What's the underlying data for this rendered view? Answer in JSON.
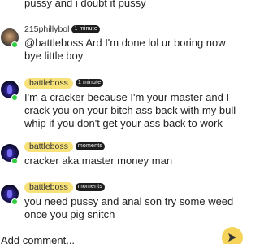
{
  "comments": [
    {
      "username": "",
      "time": "",
      "text": "pussy and i doubt it pussy"
    },
    {
      "username": "215phillybol",
      "time": "1 minute",
      "text": "@battleboss Ard I'm done lol ur boring now bye little boy"
    },
    {
      "username": "battleboss",
      "time": "1 minute",
      "text": "I'm a cracker because I'm your master and I crack you on your bitch ass back with my bull whip if you don't get your ass back to work"
    },
    {
      "username": "battleboss",
      "time": "moments",
      "text": "cracker aka master money man"
    },
    {
      "username": "battleboss",
      "time": "moments",
      "text": "you need pussy and anal son try some weed once you pig snitch"
    }
  ],
  "composer": {
    "placeholder": "Add comment..."
  },
  "colors": {
    "username_pill": "#f7e27a",
    "time_badge": "#1e1e1e",
    "online": "#2ecc40",
    "send_button": "#f6d35a"
  },
  "icons": {
    "send": "send-arrow-icon"
  }
}
